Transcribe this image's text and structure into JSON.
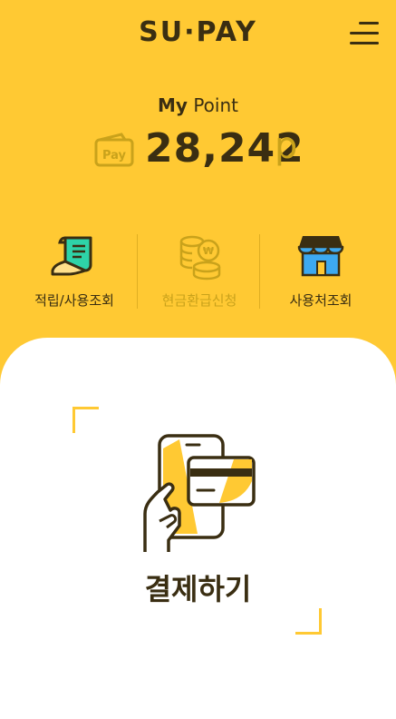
{
  "header": {
    "logo": "SU·PAY",
    "menu_icon": "hamburger-menu-icon"
  },
  "point": {
    "label_bold": "My",
    "label_rest": " Point",
    "value": "28,242",
    "unit": "p",
    "icon": "wallet-icon",
    "icon_text": "Pay"
  },
  "menu": [
    {
      "label": "적립/사용조회",
      "icon": "receipt-icon",
      "enabled": true
    },
    {
      "label": "현금환급신청",
      "icon": "coins-won-icon",
      "enabled": false
    },
    {
      "label": "사용처조회",
      "icon": "store-icon",
      "enabled": true
    }
  ],
  "payment": {
    "label": "결제하기",
    "icon": "hand-phone-card-icon"
  },
  "colors": {
    "background": "#FFC933",
    "text": "#3A2E12",
    "accent_muted": "#C9A21B",
    "green": "#2ED3A8",
    "blue": "#3DA9F0"
  }
}
